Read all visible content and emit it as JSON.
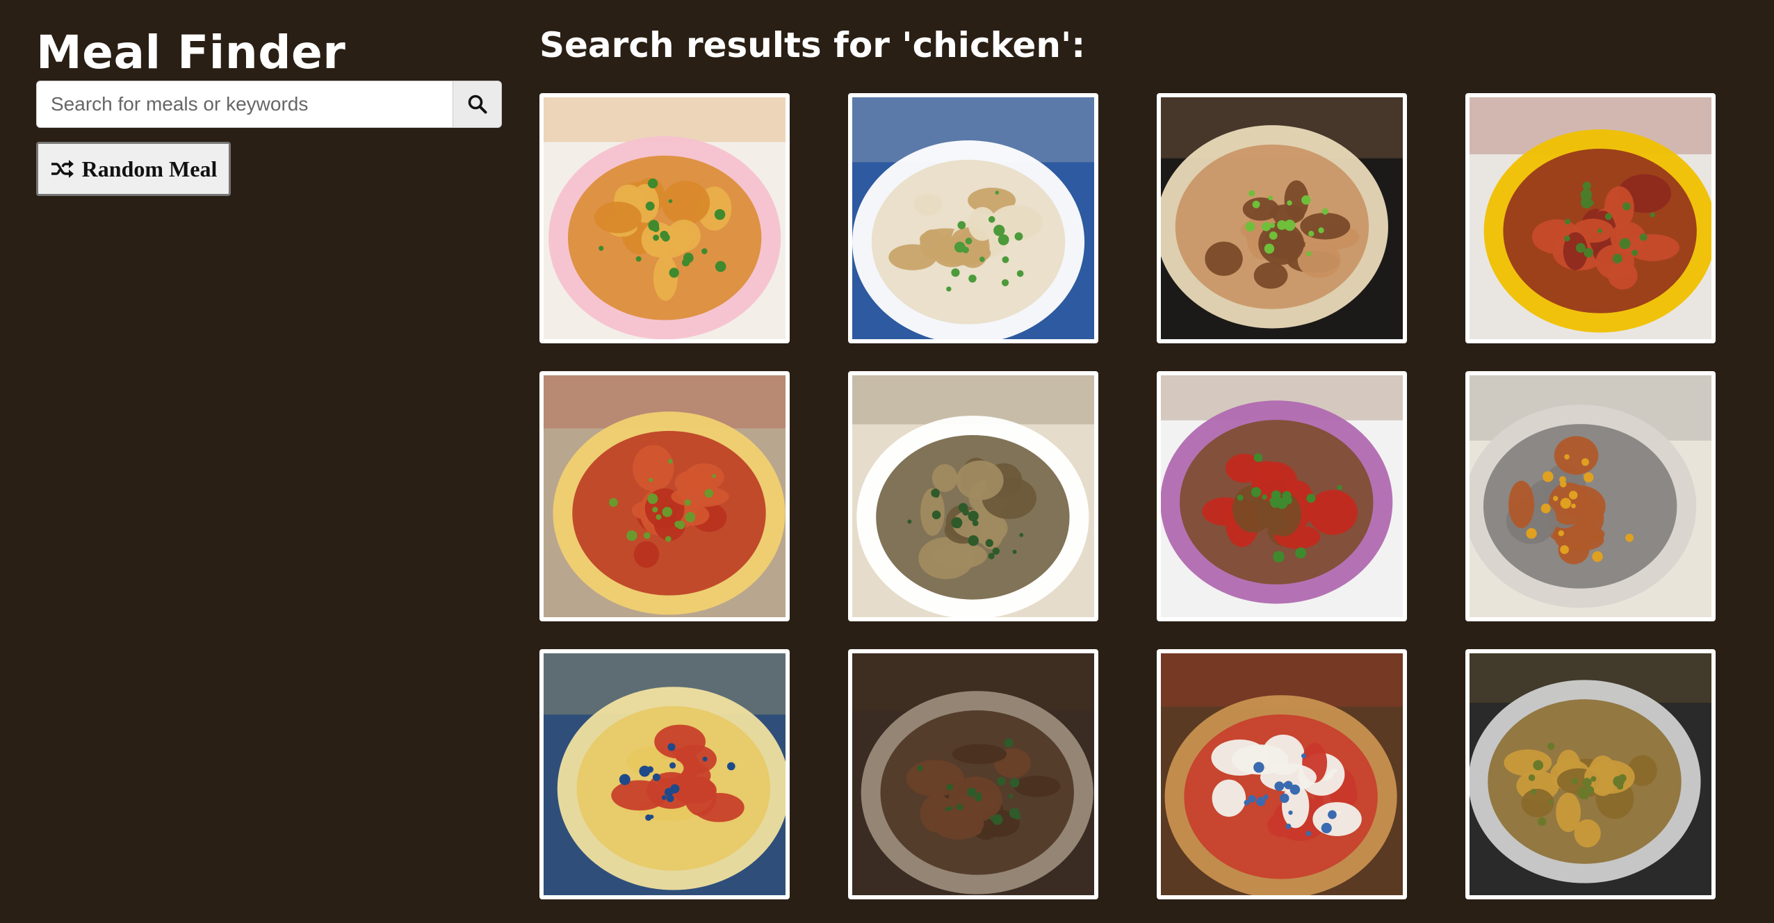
{
  "app": {
    "title": "Meal Finder"
  },
  "search": {
    "placeholder": "Search for meals or keywords",
    "value": "",
    "button_icon": "search-icon"
  },
  "random": {
    "label": "Random Meal",
    "icon": "shuffle-icon"
  },
  "results": {
    "heading": "Search results for 'chicken':",
    "meals": [
      {
        "icon": "meal-photo",
        "theme": [
          "#f3eee8",
          "#d98a2b",
          "#e9b04a",
          "#3f8a2e",
          "#f6c1cf"
        ]
      },
      {
        "icon": "meal-photo",
        "theme": [
          "#2d5aa0",
          "#e8dcc2",
          "#c9a46a",
          "#4c9a3a",
          "#ffffff"
        ]
      },
      {
        "icon": "meal-photo",
        "theme": [
          "#1c1a18",
          "#c89060",
          "#7a4a2a",
          "#6fbf3a",
          "#e9d9b8"
        ]
      },
      {
        "icon": "meal-photo",
        "theme": [
          "#e9e6e2",
          "#8e2a1e",
          "#c64b2a",
          "#4a7d2a",
          "#f0c000"
        ]
      },
      {
        "icon": "meal-photo",
        "theme": [
          "#b9a68f",
          "#b8321e",
          "#d2552e",
          "#6a9a2e",
          "#f0d070"
        ]
      },
      {
        "icon": "meal-photo",
        "theme": [
          "#e6dccb",
          "#6b5a3a",
          "#a08a60",
          "#2f5a2a",
          "#ffffff"
        ]
      },
      {
        "icon": "meal-photo",
        "theme": [
          "#f2f2f2",
          "#7a4a26",
          "#c22a1e",
          "#3f8a2e",
          "#b06ab0"
        ]
      },
      {
        "icon": "meal-photo",
        "theme": [
          "#e8e4da",
          "#7e7a78",
          "#b05a2a",
          "#e0a020",
          "#d9d4cf"
        ]
      },
      {
        "icon": "meal-photo",
        "theme": [
          "#2f4f7a",
          "#e8c860",
          "#c8402a",
          "#1f4a8a",
          "#f0e0a0"
        ]
      },
      {
        "icon": "meal-photo",
        "theme": [
          "#3a2c22",
          "#4a3020",
          "#6a4028",
          "#2f5a2a",
          "#9a8a7a"
        ]
      },
      {
        "icon": "meal-photo",
        "theme": [
          "#5a3a22",
          "#c9382a",
          "#f2f0ea",
          "#3a6ab0",
          "#c89050"
        ]
      },
      {
        "icon": "meal-photo",
        "theme": [
          "#2a2a2a",
          "#8a6a2a",
          "#c89a3a",
          "#6a7a2a",
          "#cfcfcf"
        ]
      }
    ]
  }
}
